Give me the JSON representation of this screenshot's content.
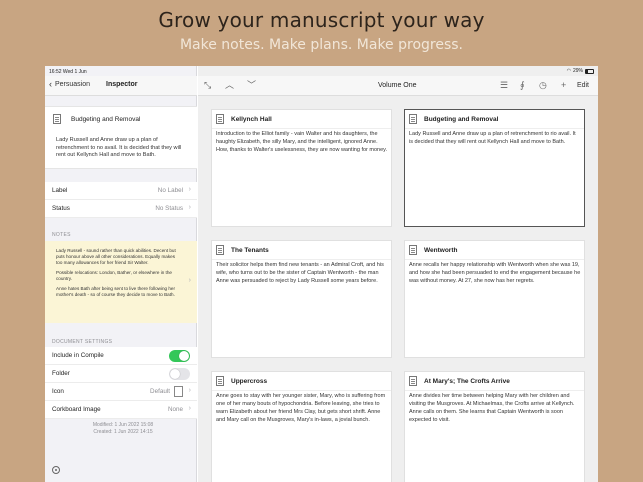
{
  "promo": {
    "headline": "Grow your manuscript your way",
    "subline": "Make notes. Make plans. Make progress."
  },
  "status_bar": {
    "time": "16:52  Wed 1 Jun",
    "battery": "29%"
  },
  "inspector": {
    "back_label": "Persuasion",
    "title": "Inspector",
    "synopsis": {
      "title": "Budgeting and Removal",
      "text": "Lady Russell and Anne draw up a plan of retrenchment to no avail. It is decided that they will rent out Kellynch Hall and move to Bath."
    },
    "label_row": {
      "label": "Label",
      "value": "No Label"
    },
    "status_row": {
      "label": "Status",
      "value": "No Status"
    },
    "notes_heading": "NOTES",
    "notes": [
      "Lady Russell - sound rather than quick abilities. Decent but puts honour above all other considerations. Equally makes too many allowances for her friend Sir Walter.",
      "Possible relocations: London, Bather, or elsewhere in the country.",
      "Anne hates Bath after being sent to live there following her mother's death - so of course they decide to move to Bath."
    ],
    "doc_settings_heading": "DOCUMENT SETTINGS",
    "include_in_compile": {
      "label": "Include in Compile",
      "on": true
    },
    "folder": {
      "label": "Folder",
      "on": false
    },
    "icon_row": {
      "label": "Icon",
      "value": "Default"
    },
    "corkboard_row": {
      "label": "Corkboard Image",
      "value": "None"
    },
    "modified": "Modified: 1 Jun 2022  15:08",
    "created": "Created: 1 Jun 2022  14:15"
  },
  "toolbar": {
    "title": "Volume One",
    "edit_label": "Edit"
  },
  "cards": [
    {
      "title": "Kellynch Hall",
      "text": "Introduction to the Elliot family - vain Walter and his daughters, the haughty Elizabeth, the silly Mary, and the intelligent, ignored Anne. How, thanks to Walter's uselessness, they are now wanting for money."
    },
    {
      "title": "Budgeting and Removal",
      "text": "Lady Russell and Anne draw up a plan of retrenchment to rio avail. It is decided that they will rent out Kellynch Hall and move to Bath."
    },
    {
      "title": "The Tenants",
      "text": "Their solicitor helps them find new tenants - an Admiral Croft, and his wife, who turns out to be the sister of Captain Wentworth - the man Anne was persuaded to reject by Lady Russell some years before."
    },
    {
      "title": "Wentworth",
      "text": "Anne recalls her happy relationship with Wentworth when she was 19, and how she had been persuaded to end the engagement because he was without money. At 27, she now has her regrets."
    },
    {
      "title": "Uppercross",
      "text": "Anne goes to stay with her younger sister, Mary, who is suffering from one of her many bouts of hypochondria. Before leaving, she tries to warn Elizabeth about her friend Mrs Clay, but gets short shrift. Anne and Mary call on the Musgroves, Mary's in-laws, a jovial bunch."
    },
    {
      "title": "At Mary's; The Crofts Arrive",
      "text": "Anne divides her time between helping Mary with her children and visiting the Musgroves. At Michaelmas, the Crofts arrive at Kellynch. Anne calls on them. She learns that Captain Wentworth is soon expected to visit."
    }
  ]
}
